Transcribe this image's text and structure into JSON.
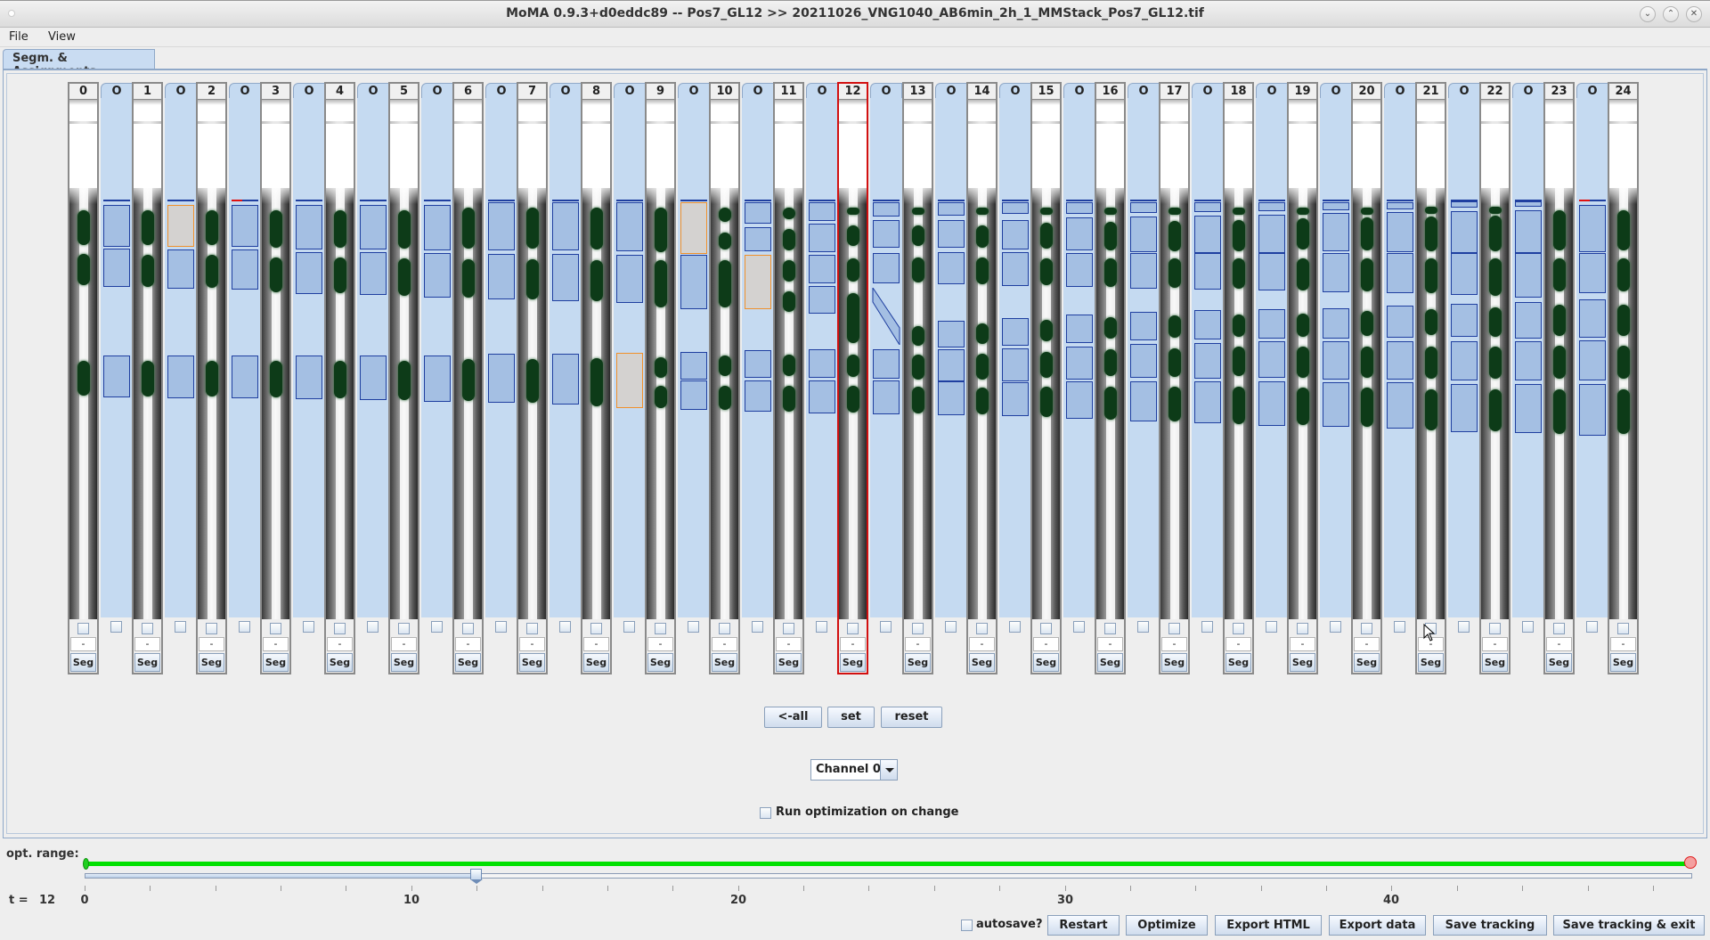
{
  "window": {
    "title": "MoMA 0.9.3+d0eddc89 -- Pos7_GL12 >> 20211026_VNG1040_AB6min_2h_1_MMStack_Pos7_GL12.tif",
    "controls": [
      "minimize-icon",
      "maximize-icon",
      "close-icon"
    ]
  },
  "menu": {
    "items": [
      {
        "label": "File"
      },
      {
        "label": "View"
      }
    ]
  },
  "tabs": [
    {
      "label": "Segm. & Assignments",
      "active": true
    }
  ],
  "columns": {
    "selected_timepoint": 12,
    "frames": [
      {
        "label": "0"
      },
      {
        "label": "1"
      },
      {
        "label": "2"
      },
      {
        "label": "3"
      },
      {
        "label": "4"
      },
      {
        "label": "5"
      },
      {
        "label": "6"
      },
      {
        "label": "7"
      },
      {
        "label": "8"
      },
      {
        "label": "9"
      },
      {
        "label": "10"
      },
      {
        "label": "11"
      },
      {
        "label": "12"
      },
      {
        "label": "13"
      },
      {
        "label": "14"
      },
      {
        "label": "15"
      },
      {
        "label": "16"
      },
      {
        "label": "17"
      },
      {
        "label": "18"
      },
      {
        "label": "19"
      },
      {
        "label": "20"
      },
      {
        "label": "21"
      },
      {
        "label": "22"
      },
      {
        "label": "23"
      },
      {
        "label": "24"
      }
    ],
    "frame_field_value": "-",
    "seg_button_label": "Seg",
    "assignment_tab_label": "O"
  },
  "assignments": [
    {
      "marker": "blue",
      "segments": [
        [
          0.205,
          0.285,
          "blue"
        ],
        [
          0.29,
          0.364,
          "blue"
        ],
        [
          0.495,
          0.575,
          "blue"
        ]
      ]
    },
    {
      "marker": "orange",
      "segments": [
        [
          0.205,
          0.285,
          "orange"
        ],
        [
          0.292,
          0.368,
          "blue"
        ],
        [
          0.495,
          0.577,
          "blue"
        ]
      ]
    },
    {
      "marker": "red",
      "segments": [
        [
          0.205,
          0.285,
          "blue"
        ],
        [
          0.292,
          0.37,
          "blue"
        ],
        [
          0.495,
          0.577,
          "blue"
        ]
      ]
    },
    {
      "marker": "blue",
      "segments": [
        [
          0.205,
          0.29,
          "blue"
        ],
        [
          0.296,
          0.376,
          "blue"
        ],
        [
          0.495,
          0.579,
          "blue"
        ]
      ]
    },
    {
      "marker": "blue",
      "segments": [
        [
          0.205,
          0.29,
          "blue"
        ],
        [
          0.296,
          0.378,
          "blue"
        ],
        [
          0.495,
          0.581,
          "blue"
        ]
      ]
    },
    {
      "marker": "blue",
      "segments": [
        [
          0.205,
          0.292,
          "blue"
        ],
        [
          0.298,
          0.383,
          "blue"
        ],
        [
          0.495,
          0.584,
          "blue"
        ]
      ]
    },
    {
      "marker": "blue",
      "segments": [
        [
          0.201,
          0.294,
          "blue"
        ],
        [
          0.3,
          0.387,
          "blue"
        ],
        [
          0.493,
          0.588,
          "blue"
        ]
      ]
    },
    {
      "marker": "blue",
      "segments": [
        [
          0.201,
          0.294,
          "blue"
        ],
        [
          0.3,
          0.391,
          "blue"
        ],
        [
          0.493,
          0.59,
          "blue"
        ]
      ]
    },
    {
      "marker": "blue",
      "segments": [
        [
          0.201,
          0.296,
          "blue"
        ],
        [
          0.302,
          0.395,
          "blue"
        ],
        [
          0.49,
          0.596,
          "orange"
        ]
      ]
    },
    {
      "marker": "orange",
      "segments": [
        [
          0.201,
          0.3,
          "orange"
        ],
        [
          0.302,
          0.406,
          "blue"
        ],
        [
          0.488,
          0.541,
          "blue"
        ],
        [
          0.543,
          0.6,
          "blue"
        ]
      ]
    },
    {
      "marker": "none",
      "segments": [
        [
          0.201,
          0.243,
          "blue"
        ],
        [
          0.249,
          0.296,
          "blue"
        ],
        [
          0.302,
          0.406,
          "orange"
        ],
        [
          0.486,
          0.539,
          "blue"
        ],
        [
          0.543,
          0.603,
          "blue"
        ]
      ]
    },
    {
      "marker": "none",
      "segments": [
        [
          0.201,
          0.237,
          "blue"
        ],
        [
          0.241,
          0.296,
          "blue"
        ],
        [
          0.302,
          0.357,
          "blue"
        ],
        [
          0.362,
          0.416,
          "blue"
        ],
        [
          0.484,
          0.539,
          "blue"
        ],
        [
          0.543,
          0.607,
          "blue"
        ]
      ]
    },
    {
      "marker": "none",
      "segments": [
        [
          0.201,
          0.228,
          "blue"
        ],
        [
          0.235,
          0.288,
          "blue"
        ],
        [
          0.298,
          0.357,
          "blue"
        ],
        [
          0.366,
          0.476,
          "diagonal"
        ],
        [
          0.484,
          0.541,
          "blue"
        ],
        [
          0.543,
          0.609,
          "blue"
        ]
      ]
    },
    {
      "marker": "none",
      "segments": [
        [
          0.201,
          0.226,
          "blue"
        ],
        [
          0.235,
          0.288,
          "blue"
        ],
        [
          0.296,
          0.357,
          "blue"
        ],
        [
          0.429,
          0.48,
          "blue"
        ],
        [
          0.484,
          0.545,
          "blue"
        ],
        [
          0.545,
          0.611,
          "blue"
        ]
      ]
    },
    {
      "marker": "none",
      "segments": [
        [
          0.201,
          0.224,
          "blue"
        ],
        [
          0.235,
          0.292,
          "blue"
        ],
        [
          0.296,
          0.362,
          "blue"
        ],
        [
          0.423,
          0.476,
          "blue"
        ],
        [
          0.482,
          0.545,
          "blue"
        ],
        [
          0.548,
          0.613,
          "blue"
        ]
      ]
    },
    {
      "marker": "none",
      "segments": [
        [
          0.201,
          0.224,
          "blue"
        ],
        [
          0.23,
          0.294,
          "blue"
        ],
        [
          0.298,
          0.364,
          "blue"
        ],
        [
          0.416,
          0.471,
          "blue"
        ],
        [
          0.478,
          0.541,
          "blue"
        ],
        [
          0.545,
          0.617,
          "blue"
        ]
      ]
    },
    {
      "marker": "none",
      "segments": [
        [
          0.201,
          0.222,
          "blue"
        ],
        [
          0.228,
          0.296,
          "blue"
        ],
        [
          0.298,
          0.366,
          "blue"
        ],
        [
          0.412,
          0.467,
          "blue"
        ],
        [
          0.474,
          0.539,
          "blue"
        ],
        [
          0.545,
          0.622,
          "blue"
        ]
      ]
    },
    {
      "marker": "none",
      "segments": [
        [
          0.201,
          0.22,
          "blue"
        ],
        [
          0.226,
          0.298,
          "blue"
        ],
        [
          0.298,
          0.368,
          "blue"
        ],
        [
          0.408,
          0.465,
          "blue"
        ],
        [
          0.471,
          0.539,
          "blue"
        ],
        [
          0.545,
          0.626,
          "blue"
        ]
      ]
    },
    {
      "marker": "none",
      "segments": [
        [
          0.201,
          0.218,
          "blue"
        ],
        [
          0.224,
          0.298,
          "blue"
        ],
        [
          0.298,
          0.37,
          "blue"
        ],
        [
          0.406,
          0.463,
          "blue"
        ],
        [
          0.469,
          0.539,
          "blue"
        ],
        [
          0.545,
          0.63,
          "blue"
        ]
      ]
    },
    {
      "marker": "none",
      "segments": [
        [
          0.201,
          0.216,
          "blue"
        ],
        [
          0.222,
          0.296,
          "blue"
        ],
        [
          0.298,
          0.374,
          "blue"
        ],
        [
          0.404,
          0.463,
          "blue"
        ],
        [
          0.469,
          0.543,
          "blue"
        ],
        [
          0.548,
          0.634,
          "blue"
        ]
      ]
    },
    {
      "marker": "none",
      "segments": [
        [
          0.201,
          0.214,
          "blue"
        ],
        [
          0.22,
          0.298,
          "blue"
        ],
        [
          0.298,
          0.376,
          "blue"
        ],
        [
          0.4,
          0.461,
          "blue"
        ],
        [
          0.469,
          0.543,
          "blue"
        ],
        [
          0.548,
          0.638,
          "blue"
        ]
      ]
    },
    {
      "marker": "none",
      "segments": [
        [
          0.199,
          0.211,
          "blue"
        ],
        [
          0.218,
          0.298,
          "blue"
        ],
        [
          0.298,
          0.378,
          "blue"
        ],
        [
          0.397,
          0.461,
          "blue"
        ],
        [
          0.469,
          0.545,
          "blue"
        ],
        [
          0.55,
          0.643,
          "blue"
        ]
      ]
    },
    {
      "marker": "none",
      "segments": [
        [
          0.199,
          0.209,
          "blue"
        ],
        [
          0.216,
          0.298,
          "blue"
        ],
        [
          0.298,
          0.383,
          "blue"
        ],
        [
          0.393,
          0.463,
          "blue"
        ],
        [
          0.469,
          0.545,
          "blue"
        ],
        [
          0.55,
          0.645,
          "blue"
        ]
      ]
    },
    {
      "marker": "red",
      "segments": [
        [
          0.205,
          0.296,
          "blue"
        ],
        [
          0.298,
          0.376,
          "blue"
        ],
        [
          0.387,
          0.461,
          "blue"
        ],
        [
          0.467,
          0.545,
          "blue"
        ],
        [
          0.55,
          0.649,
          "blue"
        ]
      ]
    }
  ],
  "controls": {
    "all_label": "<-all",
    "set_label": "set",
    "reset_label": "reset",
    "channel_selected": "Channel 0",
    "run_opt_label": "Run optimization on change",
    "run_opt_checked": false
  },
  "timeline": {
    "opt_range_label": "opt. range:",
    "opt_range": [
      0,
      49
    ],
    "t_label": "t =",
    "t_value": "12",
    "min": 0,
    "max": 49,
    "current": 12,
    "tick_labels": [
      "0",
      "10",
      "20",
      "30",
      "40"
    ]
  },
  "footer": {
    "autosave_label": "autosave?",
    "autosave_checked": false,
    "buttons": [
      {
        "label": "Restart"
      },
      {
        "label": "Optimize"
      },
      {
        "label": "Export HTML"
      },
      {
        "label": "Export data"
      },
      {
        "label": "Save tracking"
      },
      {
        "label": "Save tracking & exit"
      }
    ]
  }
}
